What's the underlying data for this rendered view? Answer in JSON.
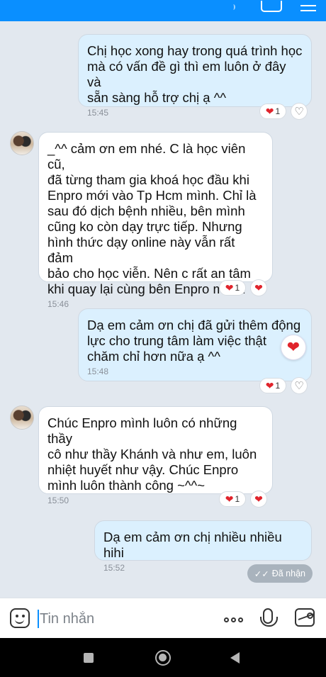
{
  "colors": {
    "accent": "#0a8fff",
    "outgoing_bubble": "#dbf0fe",
    "incoming_bubble": "#ffffff",
    "heart": "#e0242c"
  },
  "messages": [
    {
      "sender": "me",
      "text": "Chị học xong hay trong quá trình học\nmà có vấn đề gì thì em luôn ở đây và\nsẵn sàng hỗ trợ chị ạ ^^",
      "time": "15:45",
      "reaction_count": "1"
    },
    {
      "sender": "them",
      "text": "_^^ cảm ơn em nhé. C là học viên cũ,\nđã từng tham gia khoá học đầu khi\nEnpro mới vào Tp Hcm mình. Chỉ là\nsau đó dịch bệnh nhiều, bên mình\ncũng ko còn dạy trực tiếp. Nhưng\nhình thức dạy online này vẫn rất đảm\nbảo cho học viễn. Nên c rất an tâm\nkhi quay lại cùng bên Enpro mình.",
      "time": "15:46",
      "reaction_count": "1"
    },
    {
      "sender": "me",
      "text": "Dạ em cảm ơn chị đã gửi thêm động\nlực cho trung tâm làm việc thật\nchăm chỉ hơn nữa ạ ^^",
      "time": "15:48",
      "reaction_count": "1"
    },
    {
      "sender": "them",
      "text": "Chúc Enpro mình luôn có những thầy\ncô như thầy Khánh và như em, luôn\nnhiệt huyết như vậy. Chúc Enpro\nmình luôn thành công ~^^~",
      "time": "15:50",
      "reaction_count": "1"
    },
    {
      "sender": "me",
      "text": "Dạ em cảm ơn chị nhiều nhiều hihi",
      "time": "15:52"
    }
  ],
  "status": {
    "label": "Đã nhận",
    "icon": "double-check-icon"
  },
  "composer": {
    "placeholder": "Tin nhắn"
  },
  "icons": {
    "heart": "heart-icon",
    "heart_outline": "heart-outline-icon",
    "emoji": "emoji-icon",
    "more": "more-icon",
    "mic": "microphone-icon",
    "image": "image-icon"
  }
}
